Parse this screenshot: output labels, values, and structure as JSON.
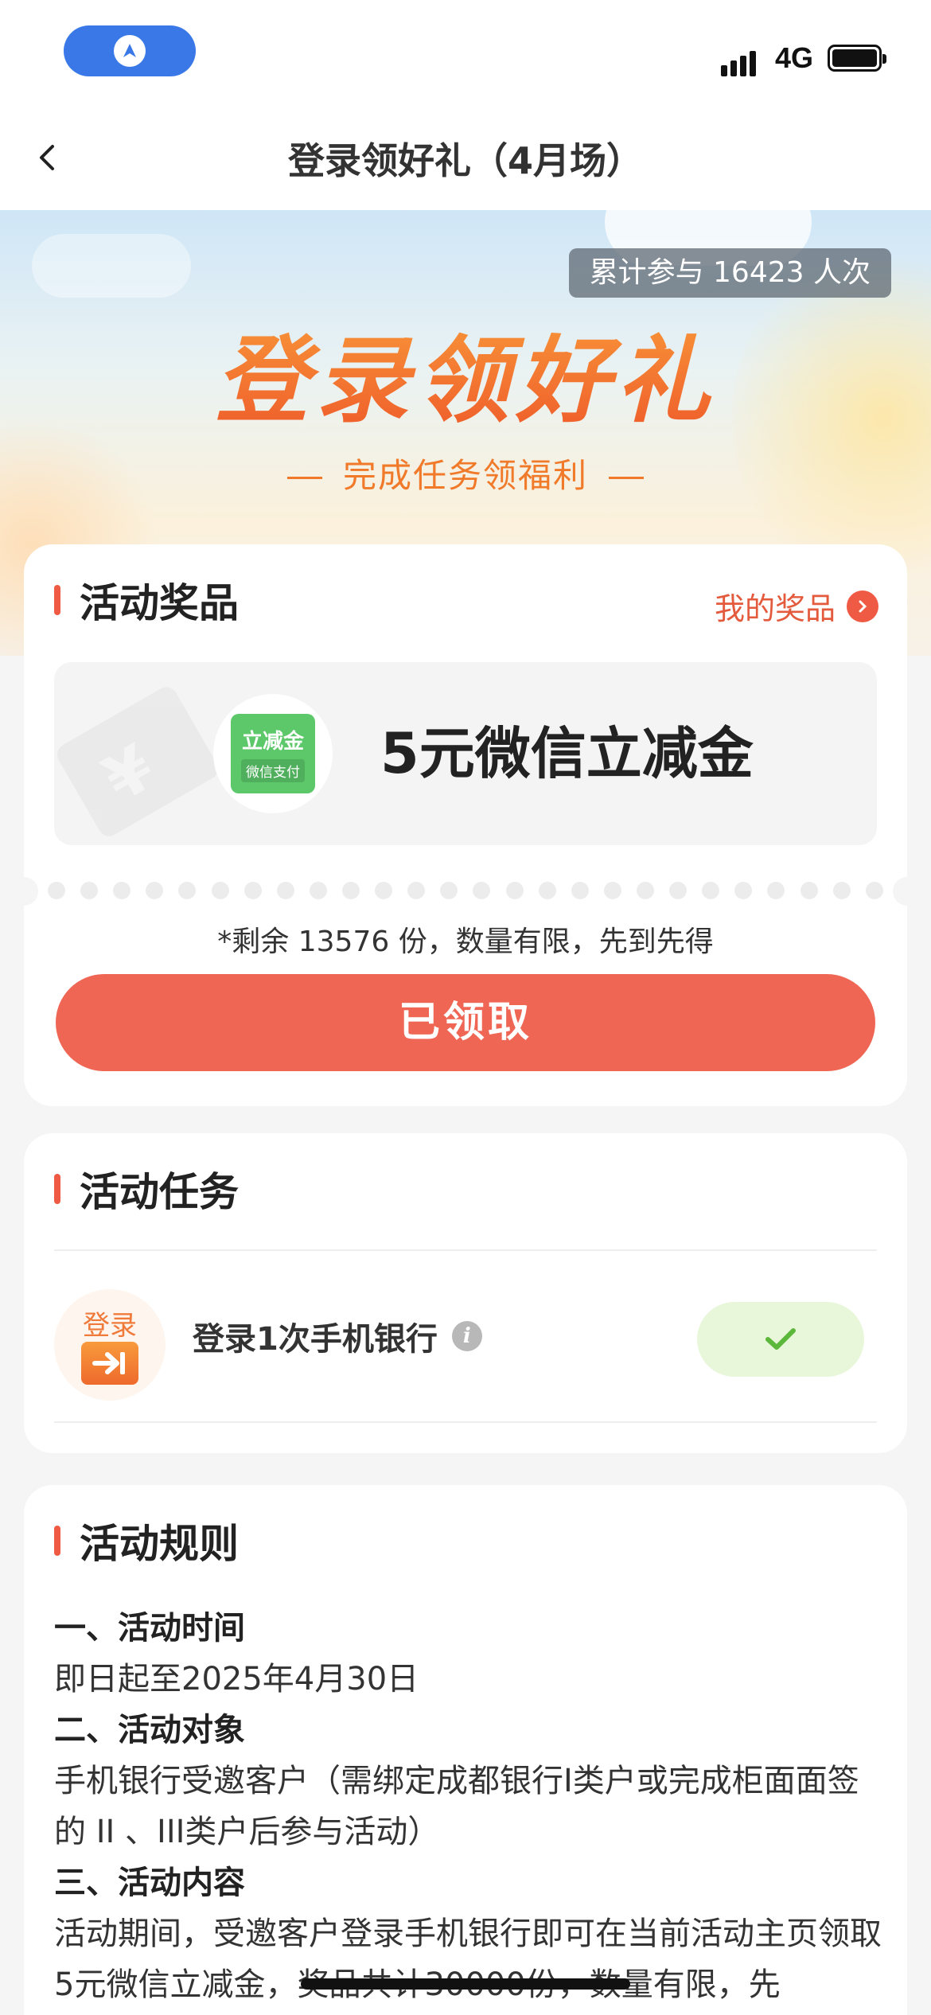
{
  "status_bar": {
    "network": "4G",
    "icons": [
      "location-arrow-icon",
      "signal-icon",
      "battery-icon"
    ]
  },
  "nav": {
    "title": "登录领好礼（4月场）",
    "back_icon": "chevron-left-icon"
  },
  "hero": {
    "participants_text": "累计参与 16423 人次",
    "title": "登录领好礼",
    "subtitle": "完成任务领福利"
  },
  "prize_section": {
    "heading": "活动奖品",
    "my_prizes_label": "我的奖品",
    "coupon_badge_top": "立减金",
    "coupon_badge_bottom": "微信支付",
    "prize_name": "5元微信立减金",
    "remaining_text": "*剩余 13576 份，数量有限，先到先得",
    "claim_button_label": "已领取"
  },
  "task_section": {
    "heading": "活动任务",
    "task_icon_label": "登录",
    "task_name": "登录1次手机银行",
    "info_icon": "i",
    "status": "completed"
  },
  "rules_section": {
    "heading": "活动规则",
    "items": [
      {
        "title": "一、活动时间",
        "body": "即日起至2025年4月30日"
      },
      {
        "title": "二、活动对象",
        "body": "手机银行受邀客户（需绑定成都银行I类户或完成柜面面签的 II 、III类户后参与活动）"
      },
      {
        "title": "三、活动内容",
        "body": "活动期间，受邀客户登录手机银行即可在当前活动主页领取5元微信立减金，奖品共计30000份，数量有限，先"
      }
    ]
  },
  "colors": {
    "accent_red": "#ef6654",
    "title_orange": "#f0652d",
    "nav_blue": "#3a78e8",
    "done_green": "#5cb83a"
  }
}
